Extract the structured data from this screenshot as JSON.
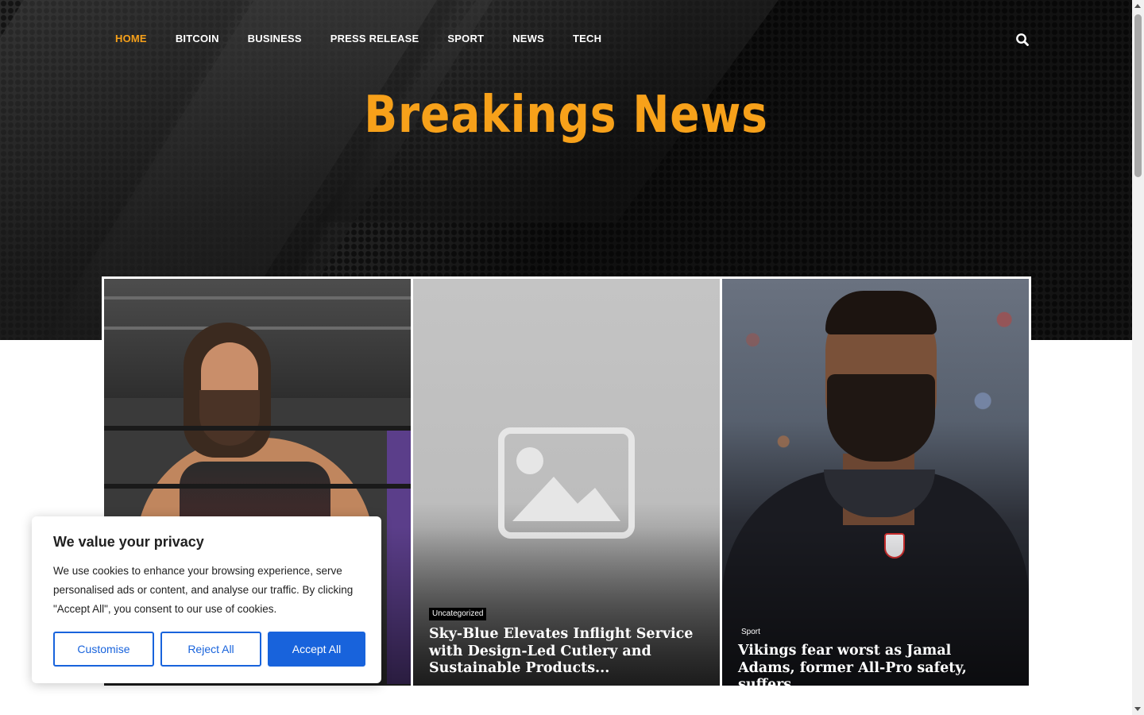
{
  "nav": {
    "items": [
      {
        "label": "HOME",
        "active": true
      },
      {
        "label": "BITCOIN"
      },
      {
        "label": "BUSINESS"
      },
      {
        "label": "PRESS RELEASE"
      },
      {
        "label": "SPORT"
      },
      {
        "label": "NEWS"
      },
      {
        "label": "TECH"
      }
    ],
    "search_icon": "search-icon"
  },
  "site": {
    "title": "Breakings News",
    "accent_color": "#f7a11a"
  },
  "featured": [
    {
      "category": "",
      "title": ""
    },
    {
      "category": "Uncategorized",
      "title": "Sky-Blue Elevates Inflight Service with Design-Led Cutlery and Sustainable Products..."
    },
    {
      "category": "Sport",
      "title": "Vikings fear worst as Jamal Adams, former All-Pro safety, suffers..."
    }
  ],
  "cookie": {
    "title": "We value your privacy",
    "text": "We use cookies to enhance your browsing experience, serve personalised ads or content, and analyse our traffic. By clicking \"Accept All\", you consent to our use of cookies.",
    "customise_label": "Customise",
    "reject_label": "Reject All",
    "accept_label": "Accept All",
    "button_color": "#1863dc"
  }
}
